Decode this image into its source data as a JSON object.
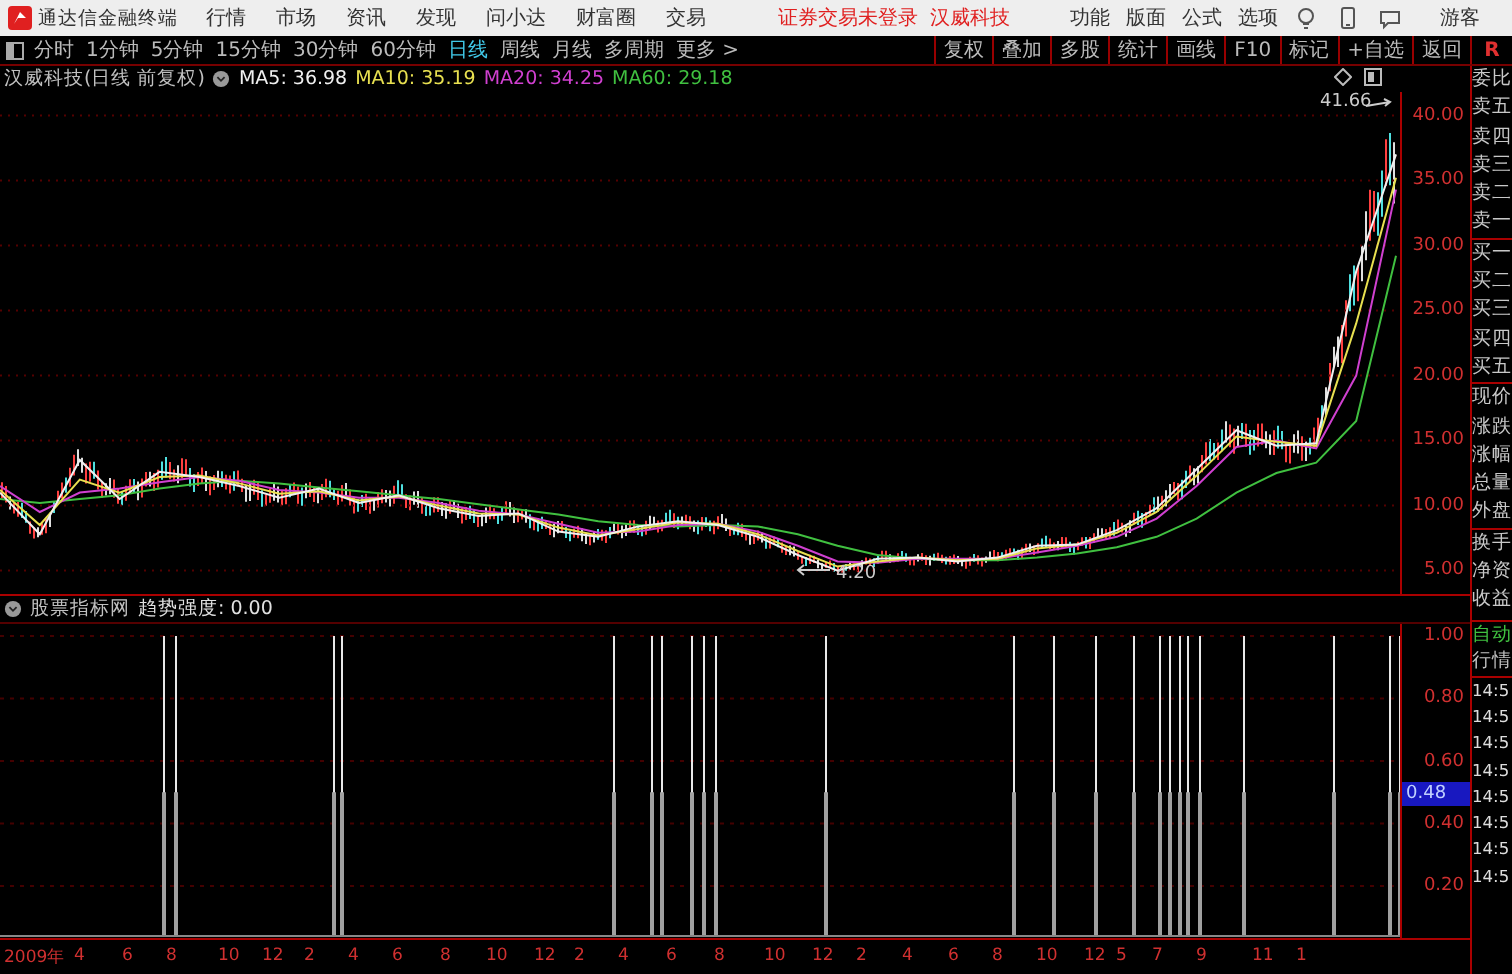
{
  "menubar": {
    "app_title": "通达信金融终端",
    "menus": [
      "行情",
      "市场",
      "资讯",
      "发现",
      "问小达",
      "财富圈",
      "交易"
    ],
    "notice": "证券交易未登录",
    "stock": "汉威科技",
    "actions": [
      "功能",
      "版面",
      "公式",
      "选项"
    ],
    "user": "游客"
  },
  "period_tabs": [
    {
      "label": "分时",
      "selected": false
    },
    {
      "label": "1分钟",
      "selected": false
    },
    {
      "label": "5分钟",
      "selected": false
    },
    {
      "label": "15分钟",
      "selected": false
    },
    {
      "label": "30分钟",
      "selected": false
    },
    {
      "label": "60分钟",
      "selected": false
    },
    {
      "label": "日线",
      "selected": true
    },
    {
      "label": "周线",
      "selected": false
    },
    {
      "label": "月线",
      "selected": false
    },
    {
      "label": "多周期",
      "selected": false
    },
    {
      "label": "更多 >",
      "selected": false
    }
  ],
  "tools": [
    "复权",
    "叠加",
    "多股",
    "统计",
    "画线",
    "F10",
    "标记",
    "+自选",
    "返回"
  ],
  "side_tab": "R",
  "legend": {
    "title": "汉威科技(日线 前复权)",
    "ma": [
      {
        "reading": ": 36.98"
      },
      {
        "reading": ": 35.19"
      },
      {
        "reading": ": 34.25"
      },
      {
        "reading": ": 29.18"
      }
    ]
  },
  "price_chart": {
    "chart_data": {
      "type": "line",
      "grid": true,
      "ylim": [
        3.2,
        41.8
      ],
      "yticks": [
        {
          "value": 5,
          "label": "5.00"
        },
        {
          "value": 10,
          "label": "10.00"
        },
        {
          "value": 15,
          "label": "15.00"
        },
        {
          "value": 20,
          "label": "20.00"
        },
        {
          "value": 25,
          "label": "25.00"
        },
        {
          "value": 30,
          "label": "30.00"
        },
        {
          "value": 35,
          "label": "35.00"
        },
        {
          "value": 40,
          "label": "40.00"
        }
      ],
      "series": [
        {
          "name": "MA5",
          "color": "#f0f0f0",
          "values": [
            11,
            7.8,
            13.5,
            10.5,
            12.6,
            12.2,
            11.5,
            10.6,
            11.3,
            10.2,
            10.8,
            9.8,
            9.2,
            9.4,
            8,
            7.6,
            8.4,
            8.8,
            8.5,
            7.6,
            6.2,
            5,
            5.9,
            6,
            5.7,
            6,
            6.9,
            7,
            8.1,
            9.8,
            12.8,
            15.8,
            14.6,
            14.8,
            28,
            37
          ]
        },
        {
          "name": "MA10",
          "color": "#e8e050",
          "values": [
            11.2,
            8.5,
            12,
            11,
            12.2,
            12.3,
            11.7,
            10.9,
            11.1,
            10.4,
            10.7,
            10,
            9.4,
            9.3,
            8.3,
            7.7,
            8.2,
            8.7,
            8.6,
            7.8,
            6.5,
            5.3,
            5.7,
            6,
            5.8,
            5.9,
            6.7,
            7,
            7.9,
            9.5,
            12.3,
            15.3,
            14.9,
            14.6,
            24,
            35.2
          ]
        },
        {
          "name": "MA20",
          "color": "#d040d0",
          "values": [
            11.5,
            9.5,
            11,
            11.3,
            11.8,
            12.2,
            11.9,
            11.2,
            11,
            10.6,
            10.6,
            10.2,
            9.6,
            9.3,
            8.6,
            7.9,
            8,
            8.5,
            8.6,
            8,
            6.9,
            5.7,
            5.6,
            5.9,
            5.9,
            5.9,
            6.4,
            6.9,
            7.6,
            9,
            11.5,
            14.5,
            15,
            14.4,
            20,
            34.3
          ]
        },
        {
          "name": "MA60",
          "color": "#40c040",
          "values": [
            10.5,
            10.2,
            10.5,
            10.8,
            11.3,
            11.7,
            11.9,
            11.7,
            11.4,
            11.1,
            10.8,
            10.5,
            10.1,
            9.7,
            9.3,
            8.8,
            8.5,
            8.4,
            8.5,
            8.4,
            7.8,
            6.9,
            6.2,
            5.9,
            5.8,
            5.8,
            6,
            6.3,
            6.8,
            7.6,
            9,
            11,
            12.5,
            13.3,
            16.5,
            29.2
          ]
        }
      ]
    }
  },
  "high_label": "41.66",
  "low_label": "4.20",
  "quote_labels": [
    "委比",
    "卖五",
    "卖四",
    "卖三",
    "卖二",
    "卖一",
    "买一",
    "买二",
    "买三",
    "买四",
    "买五",
    "现价",
    "涨跌",
    "涨幅",
    "总量",
    "外盘",
    "换手",
    "净资",
    "收益"
  ],
  "indicator": {
    "title": "股票指标网",
    "reading": "趋势强度: 0.00",
    "axis": [
      "1.00",
      "0.80",
      "0.60",
      "0.40",
      "0.20"
    ],
    "current": "0.48"
  },
  "side_panel": {
    "mode": "自动",
    "header": "行情",
    "times": [
      "14:5",
      "14:5",
      "14:5",
      "14:5",
      "14:5",
      "14:5",
      "14:5",
      "14:5"
    ]
  },
  "date_axis": [
    "2009年",
    "4",
    "6",
    "8",
    "10",
    "12",
    "2",
    "4",
    "6",
    "8",
    "10",
    "12",
    "2",
    "4",
    "6",
    "8",
    "10",
    "12",
    "2",
    "4",
    "6",
    "8",
    "10",
    "12",
    "5",
    "7",
    "9",
    "11",
    "1"
  ]
}
